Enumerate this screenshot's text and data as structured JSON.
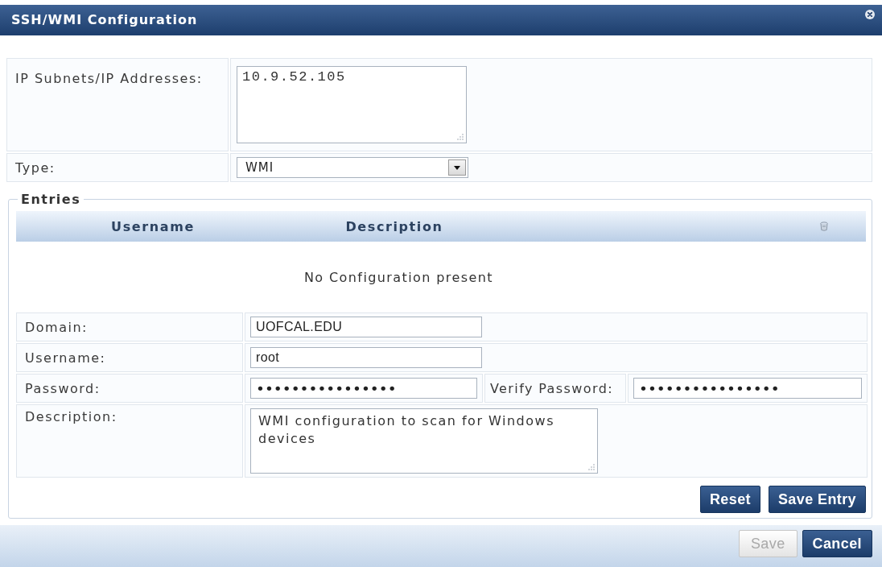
{
  "dialog": {
    "title": "SSH/WMI Configuration"
  },
  "fields": [
    {
      "label": "IP Subnets/IP Addresses:",
      "kind": "textarea",
      "value": "10.9.52.105"
    },
    {
      "label": "Type:",
      "kind": "select",
      "value": "WMI"
    }
  ],
  "entries": {
    "legend": "Entries",
    "columns": [
      "Username",
      "Description"
    ],
    "empty_message": "No Configuration present"
  },
  "entry_form": [
    {
      "label": "Domain:",
      "kind": "text",
      "value": "UOFCAL.EDU"
    },
    {
      "label": "Username:",
      "kind": "text",
      "value": "root"
    },
    {
      "label": "Password:",
      "kind": "password",
      "value": "••••••••••••••••",
      "verify_label": "Verify Password:",
      "verify_value": "••••••••••••••••"
    },
    {
      "label": "Description:",
      "kind": "textarea",
      "value": "WMI configuration to scan for Windows devices"
    }
  ],
  "entry_buttons": [
    {
      "label": "Reset",
      "disabled": false
    },
    {
      "label": "Save Entry",
      "disabled": false
    }
  ],
  "footer_buttons": [
    {
      "label": "Save",
      "disabled": true
    },
    {
      "label": "Cancel",
      "disabled": false
    }
  ]
}
